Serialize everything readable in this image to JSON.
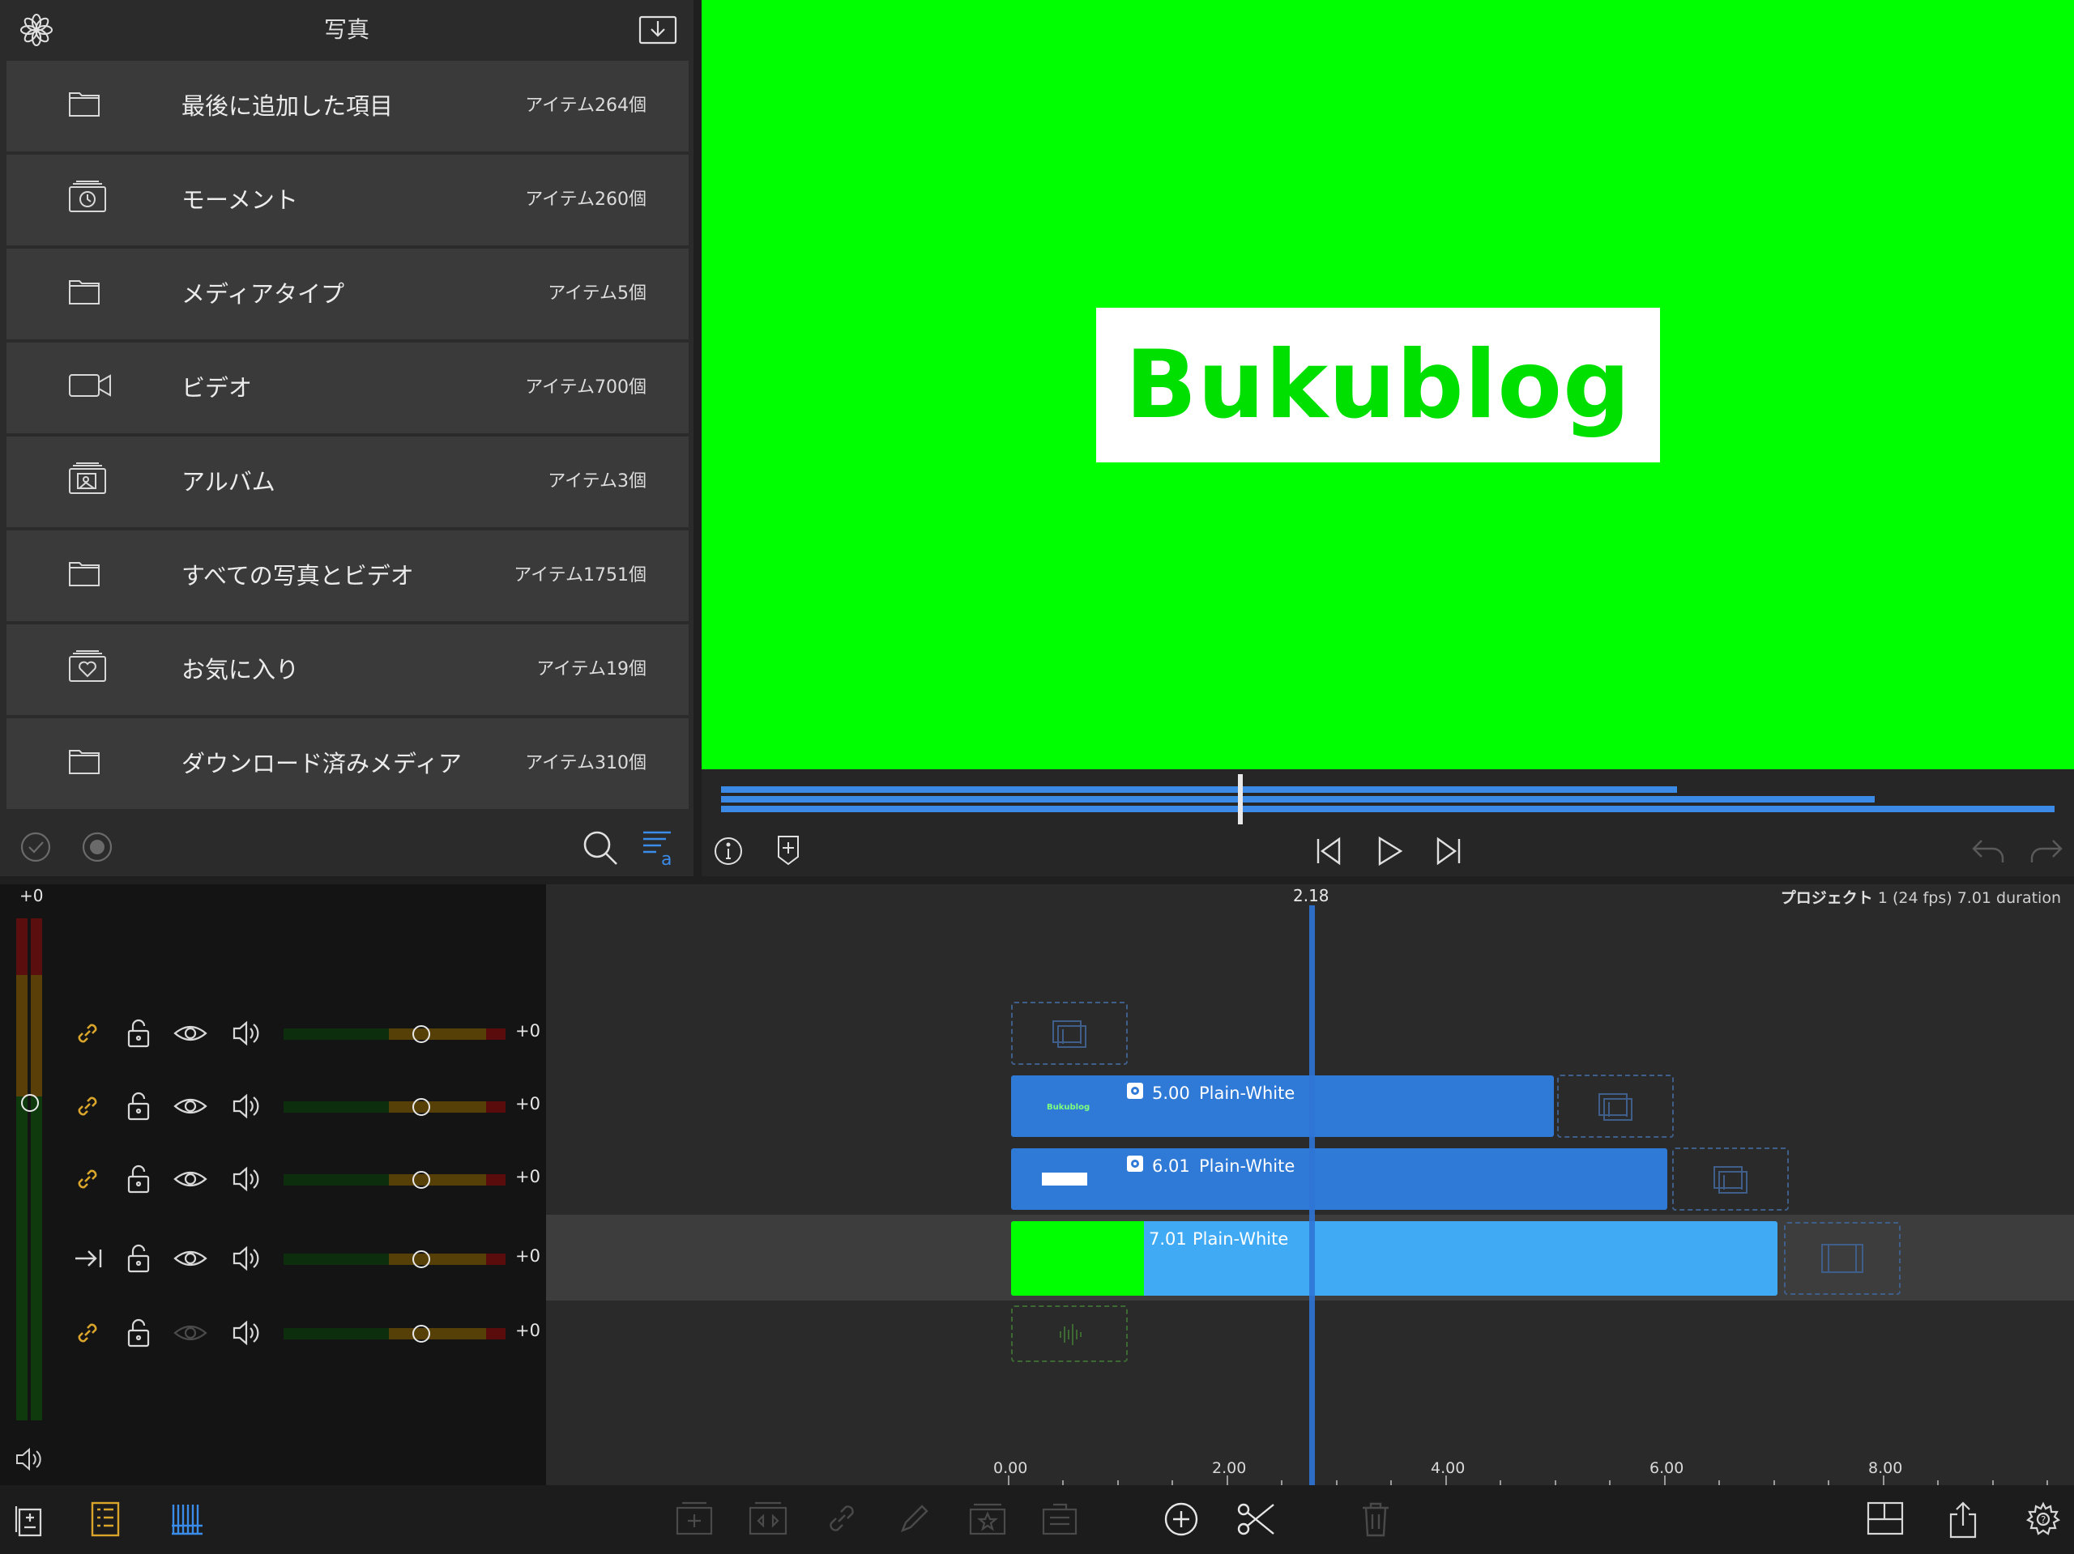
{
  "library": {
    "title": "写真",
    "items": [
      {
        "label": "最後に追加した項目",
        "count": "アイテム264個",
        "icon": "folder-icon"
      },
      {
        "label": "モーメント",
        "count": "アイテム260個",
        "icon": "moments-icon"
      },
      {
        "label": "メディアタイプ",
        "count": "アイテム5個",
        "icon": "folder-icon"
      },
      {
        "label": "ビデオ",
        "count": "アイテム700個",
        "icon": "video-camera-icon"
      },
      {
        "label": "アルバム",
        "count": "アイテム3個",
        "icon": "album-icon"
      },
      {
        "label": "すべての写真とビデオ",
        "count": "アイテム1751個",
        "icon": "folder-icon"
      },
      {
        "label": "お気に入り",
        "count": "アイテム19個",
        "icon": "favorites-icon"
      },
      {
        "label": "ダウンロード済みメディア",
        "count": "アイテム310個",
        "icon": "folder-icon"
      }
    ]
  },
  "viewer": {
    "title_text": "Bukublog",
    "preview_color": "#00ff00"
  },
  "timeline": {
    "master_level": "+0",
    "playhead_time": "2.18",
    "project_name": "プロジェクト",
    "project_meta": "1 (24 fps)  7.01 duration",
    "tracks": [
      {
        "level": "+0",
        "link_icon": "link-icon"
      },
      {
        "level": "+0",
        "link_icon": "link-icon"
      },
      {
        "level": "+0",
        "link_icon": "link-icon"
      },
      {
        "level": "+0",
        "link_icon": "arrow-right-bar-icon"
      },
      {
        "level": "+0",
        "link_icon": "link-icon"
      }
    ],
    "clips": [
      {
        "duration": "5.00",
        "name": "Plain-White"
      },
      {
        "duration": "6.01",
        "name": "Plain-White"
      },
      {
        "duration": "7.01",
        "name": "Plain-White"
      }
    ],
    "ruler": [
      "0.00",
      "2.00",
      "4.00",
      "6.00",
      "8.00"
    ]
  },
  "colors": {
    "accent": "#2f7ad6",
    "primary_clip": "#40aaf5",
    "chroma": "#00ff00",
    "gold": "#d9a52b"
  }
}
